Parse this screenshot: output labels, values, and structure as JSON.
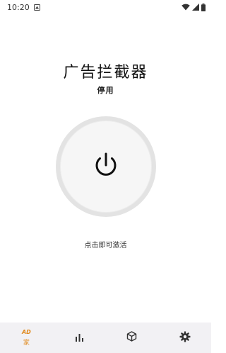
{
  "status_bar": {
    "time": "10:20",
    "icons": [
      "notification-icon",
      "wifi-icon",
      "signal-icon",
      "battery-icon"
    ]
  },
  "main": {
    "title": "广告拦截器",
    "status": "停用",
    "power_icon": "power-icon",
    "hint": "点击即可激活"
  },
  "bottom_nav": {
    "items": [
      {
        "icon": "ad-icon",
        "badge": "AD",
        "label": "家",
        "active": true
      },
      {
        "icon": "stats-icon",
        "label": "",
        "active": false
      },
      {
        "icon": "package-icon",
        "label": "",
        "active": false
      },
      {
        "icon": "gear-icon",
        "label": "",
        "active": false
      }
    ]
  },
  "colors": {
    "accent": "#e08a1e",
    "nav_background": "#f2f1f4",
    "ring_outer": "#e3e3e3",
    "ring_inner": "#f6f6f6"
  }
}
